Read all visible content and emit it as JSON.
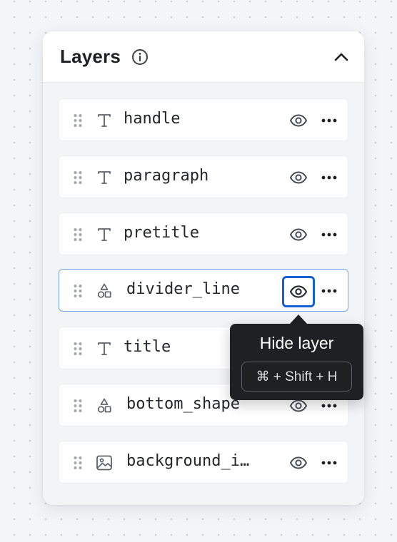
{
  "panel": {
    "title": "Layers",
    "info_icon": "info-circle-icon",
    "collapse_icon": "chevron-up-icon"
  },
  "layers": [
    {
      "name": "handle",
      "icon": "text-icon",
      "visible": true,
      "selected": false
    },
    {
      "name": "paragraph",
      "icon": "text-icon",
      "visible": true,
      "selected": false
    },
    {
      "name": "pretitle",
      "icon": "text-icon",
      "visible": true,
      "selected": false
    },
    {
      "name": "divider_line",
      "icon": "shapes-icon",
      "visible": true,
      "selected": true
    },
    {
      "name": "title",
      "icon": "text-icon",
      "visible": true,
      "selected": false
    },
    {
      "name": "bottom_shape",
      "icon": "shapes-icon",
      "visible": true,
      "selected": false
    },
    {
      "name": "background_i…",
      "icon": "image-icon",
      "visible": true,
      "selected": false
    }
  ],
  "tooltip": {
    "title": "Hide layer",
    "shortcut": "⌘ + Shift + H"
  },
  "colors": {
    "accent": "#1360d6",
    "selected_border": "#6fa4ea",
    "tooltip_bg": "#1f2023"
  }
}
